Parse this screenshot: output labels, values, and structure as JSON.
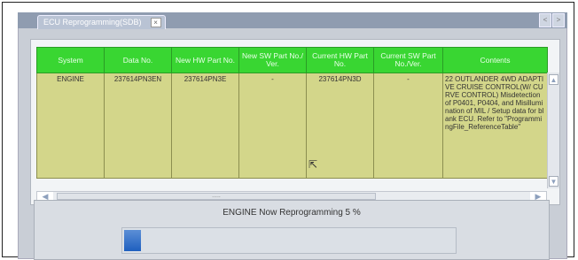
{
  "window": {
    "tab_title": "ECU Reprogramming(SDB)",
    "tab_close_glyph": "×",
    "title_buttons": [
      "<",
      ">"
    ]
  },
  "table": {
    "headers": [
      "System",
      "Data No.",
      "New HW Part No.",
      "New SW Part No./ Ver.",
      "Current HW Part No.",
      "Current SW Part No./Ver.",
      "Contents"
    ],
    "rows": [
      [
        "ENGINE",
        "237614PN3EN",
        "237614PN3E",
        "-",
        "237614PN3D",
        "-",
        "22 OUTLANDER 4WD ADAPTIVE CRUISE CONTROL(W/ CURVE CONTROL)   Misdetection of P0401, P0404, and Misillumination of MIL / Setup data for blank ECU. Refer to \"ProgrammingFile_ReferenceTable\""
      ]
    ]
  },
  "scroll": {
    "up_icon": "chevron-up-icon",
    "down_icon": "chevron-down-icon",
    "left_icon": "chevron-left-icon",
    "right_icon": "chevron-right-icon",
    "thumb_mark": "....."
  },
  "status": {
    "message": "ENGINE Now Reprogramming 5 %",
    "progress_percent": 5
  },
  "colors": {
    "header_green": "#39d632",
    "row_fill": "#d3d68a",
    "progress_blue": "#1e5fbf"
  }
}
